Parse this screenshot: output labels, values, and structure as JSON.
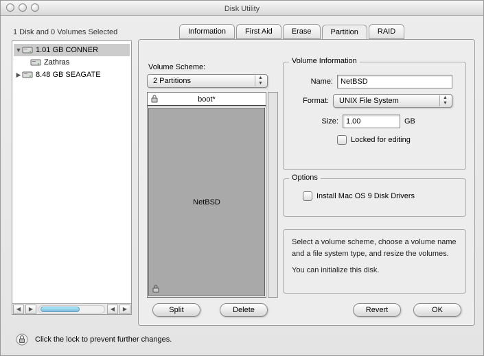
{
  "window": {
    "title": "Disk Utility"
  },
  "status": "1 Disk and 0 Volumes Selected",
  "tabs": {
    "info": "Information",
    "firstaid": "First Aid",
    "erase": "Erase",
    "partition": "Partition",
    "raid": "RAID"
  },
  "sidebar": {
    "disks": [
      {
        "label": "1.01 GB CONNER",
        "expanded": true,
        "selected": true,
        "children": [
          {
            "label": "Zathras"
          }
        ]
      },
      {
        "label": "8.48 GB SEAGATE",
        "expanded": false,
        "selected": false,
        "children": []
      }
    ]
  },
  "scheme": {
    "label": "Volume Scheme:",
    "selected": "2 Partitions",
    "partitions": [
      {
        "name": "boot*"
      },
      {
        "name": "NetBSD"
      }
    ]
  },
  "volinfo": {
    "title": "Volume Information",
    "name_label": "Name:",
    "name_value": "NetBSD",
    "format_label": "Format:",
    "format_value": "UNIX File System",
    "size_label": "Size:",
    "size_value": "1.00",
    "size_unit": "GB",
    "locked_label": "Locked for editing"
  },
  "options": {
    "title": "Options",
    "mac9_label": "Install Mac OS 9 Disk Drivers"
  },
  "help": {
    "line1": "Select a volume scheme, choose a volume name and a file system type, and resize the volumes.",
    "line2": "You can initialize this disk."
  },
  "buttons": {
    "split": "Split",
    "delete": "Delete",
    "revert": "Revert",
    "ok": "OK"
  },
  "footer": {
    "text": "Click the lock to prevent further changes."
  }
}
